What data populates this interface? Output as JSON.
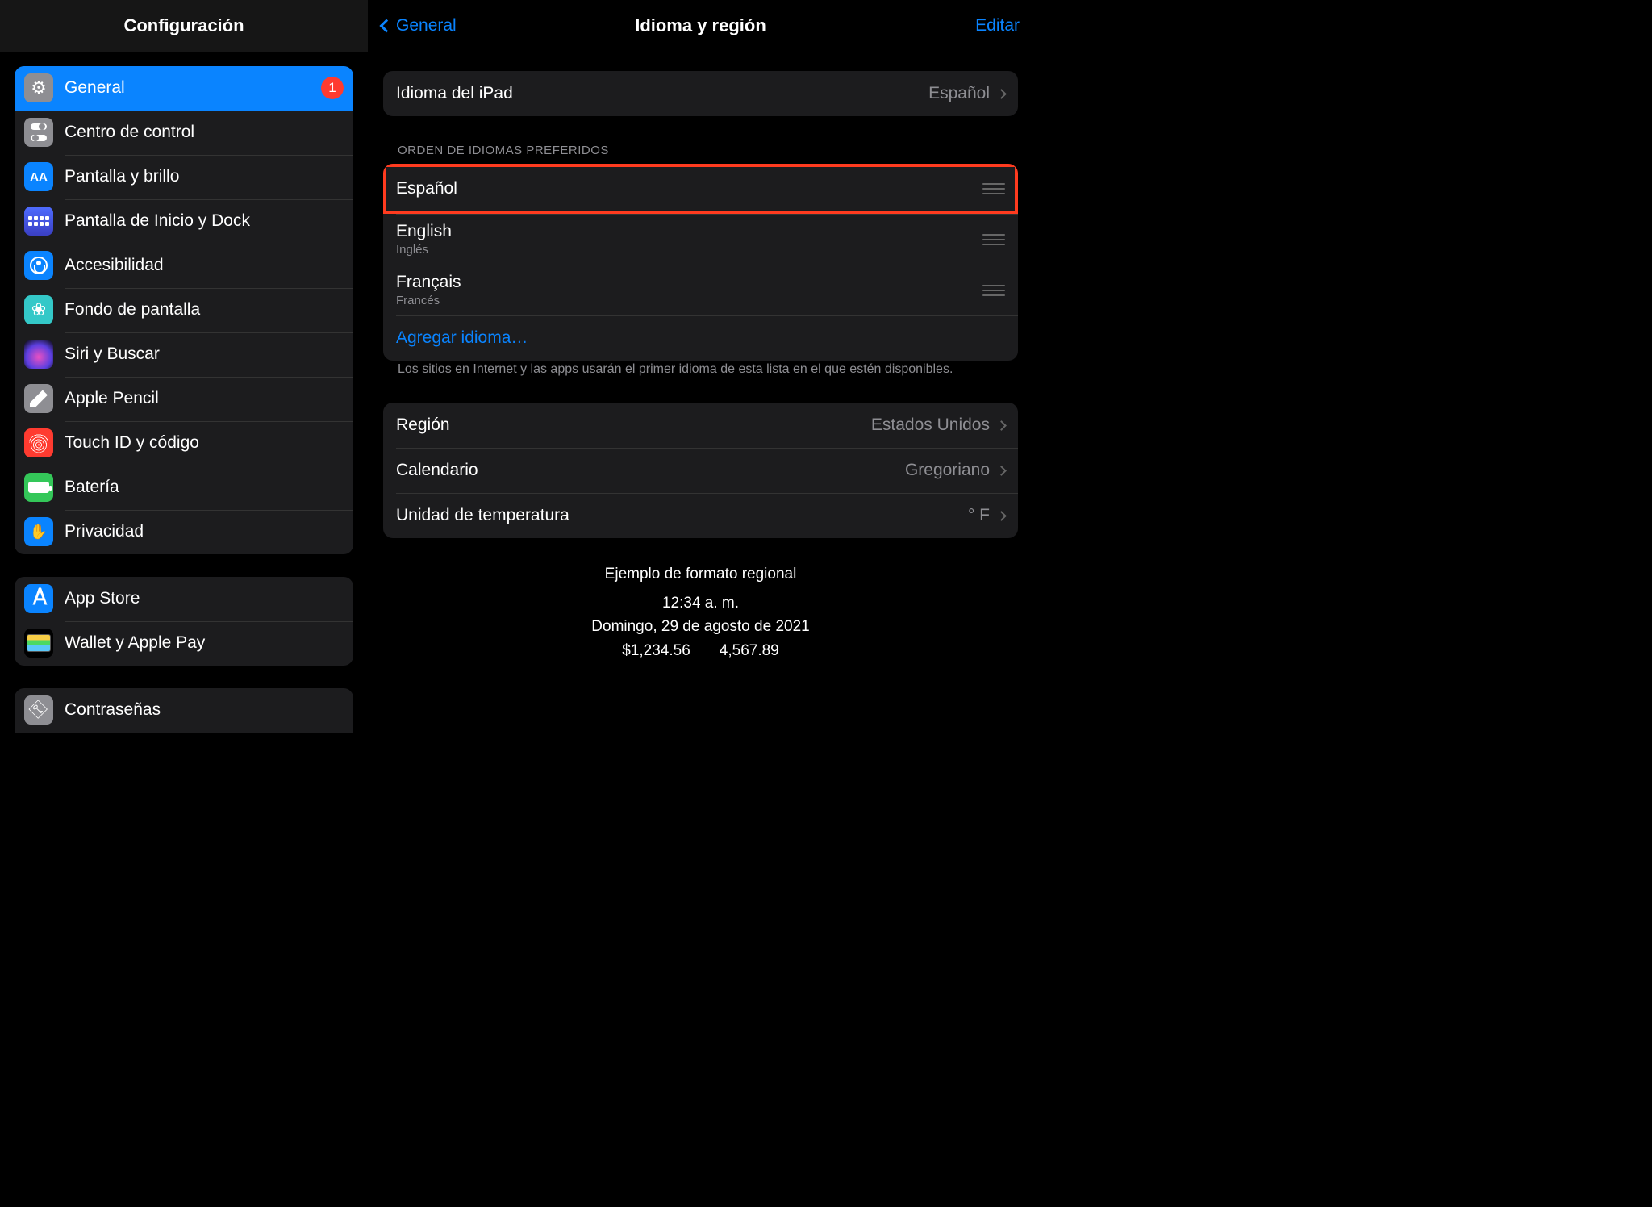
{
  "sidebar": {
    "title": "Configuración",
    "group1": [
      {
        "label": "General",
        "icon": "gear-icon",
        "badge": "1",
        "selected": true
      },
      {
        "label": "Centro de control",
        "icon": "switches-icon"
      },
      {
        "label": "Pantalla y brillo",
        "icon": "aa-icon",
        "iconText": "AA"
      },
      {
        "label": "Pantalla de Inicio y Dock",
        "icon": "grid-icon"
      },
      {
        "label": "Accesibilidad",
        "icon": "accessibility-icon"
      },
      {
        "label": "Fondo de pantalla",
        "icon": "flower-icon"
      },
      {
        "label": "Siri y Buscar",
        "icon": "siri-icon"
      },
      {
        "label": "Apple Pencil",
        "icon": "pencil-icon"
      },
      {
        "label": "Touch ID y código",
        "icon": "fingerprint-icon"
      },
      {
        "label": "Batería",
        "icon": "battery-icon"
      },
      {
        "label": "Privacidad",
        "icon": "hand-icon"
      }
    ],
    "group2": [
      {
        "label": "App Store",
        "icon": "appstore-icon"
      },
      {
        "label": "Wallet y Apple Pay",
        "icon": "wallet-icon"
      }
    ],
    "group3": [
      {
        "label": "Contraseñas",
        "icon": "key-icon"
      }
    ]
  },
  "main": {
    "back": "General",
    "title": "Idioma y región",
    "edit": "Editar",
    "ipad_language": {
      "label": "Idioma del iPad",
      "value": "Español"
    },
    "pref_header": "ORDEN DE IDIOMAS PREFERIDOS",
    "languages": [
      {
        "name": "Español",
        "sub": "",
        "highlight": true
      },
      {
        "name": "English",
        "sub": "Inglés",
        "highlight": false
      },
      {
        "name": "Français",
        "sub": "Francés",
        "highlight": false
      }
    ],
    "add_language": "Agregar idioma…",
    "footer_note": "Los sitios en Internet y las apps usarán el primer idioma de esta lista en el que estén disponibles.",
    "region": {
      "label": "Región",
      "value": "Estados Unidos"
    },
    "calendar": {
      "label": "Calendario",
      "value": "Gregoriano"
    },
    "temperature": {
      "label": "Unidad de temperatura",
      "value": "° F"
    },
    "example": {
      "title": "Ejemplo de formato regional",
      "time": "12:34 a. m.",
      "date": "Domingo, 29 de agosto de 2021",
      "num1": "$1,234.56",
      "num2": "4,567.89"
    }
  }
}
